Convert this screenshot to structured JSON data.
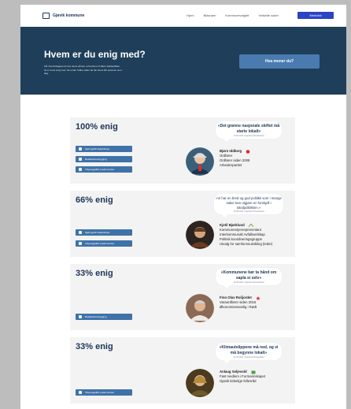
{
  "header": {
    "brand": "Gjøvik kommune",
    "nav": [
      "Hjem",
      "Blasnøm",
      "Kommunevalgett",
      "Vedtatte saker"
    ],
    "cta": "Medvirkt"
  },
  "hero": {
    "title": "Hvem er du enig med?",
    "lede": "Gå i fra forslagene du har stemt på hen et fremtil en hvilken lokalpolitiker du er mest enig med. Se under hvilke saker de har stemt likt sammen som deg.",
    "button": "Hva mener du?"
  },
  "cards": [
    {
      "pct": "100% enig",
      "pills": [
        "Sjøringsfritt fiskefriheter",
        "Boadliolokosbygging",
        "Tilrjenageliffor lokalt kunster"
      ],
      "quote": "«Det grønne nasjonale skiftet må starte lokalt»",
      "src": "13.09.2023 | Oppland Arbeiderblad",
      "name": "Bjørn Iddberg",
      "lines": [
        "Ordfører",
        "Ordfører siden 2008",
        "Arbeiderpartiet"
      ],
      "party_color": "#d9273b"
    },
    {
      "pct": "66% enig",
      "pills": [
        "Sjøringsfritt fiskefriheter",
        "Tilrjenageliffor lokalt kunster"
      ],
      "quote": "«Vi har en bred og god politikk som i mange saker kan utgjøre en forskjell i lokalpolitikken.»",
      "src": "20.08.2023 | Oppland Arbeiderblad",
      "name": "Kjetil Bjørklund",
      "lines": [
        "Kommunestyrerepresentant",
        "Interkommunalt Avfallsselskap",
        "Politisk koordineringsgruppe",
        "Utvalg for samfunnsutvikling (leder)"
      ],
      "party_color": "#6fae3a"
    },
    {
      "pct": "33% enig",
      "pills": [
        "Boadliolokosbygging"
      ],
      "quote": "«Kommunene bør ta hånd om sapla si selv»",
      "src": "29.05.2023 | Oppland Arbeiderblad",
      "name": "Finn Olav Rolijordet",
      "lines": [
        "Varaordfører siden 2015",
        "Økonomiansvarlig i Rødt"
      ],
      "party_color": "#d9273b"
    },
    {
      "pct": "33% enig",
      "pills": [
        "Tilrjenageliffor lokalt kunster"
      ],
      "quote": "«Klimautslippene må ned, og vi må begynne lokalt»",
      "src": "04.02.2023 | Oppland Arbeiderblad",
      "name": "Anlaug Seljevold",
      "lines": [
        "Fast medlem i Formannskapet",
        "Gjøvik kirkelige fellesråd"
      ],
      "party_color": "#4aa14a"
    }
  ]
}
